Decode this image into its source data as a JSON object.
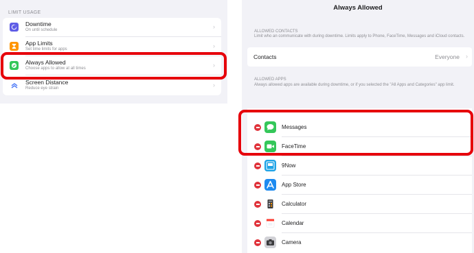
{
  "left": {
    "section_header": "LIMIT USAGE",
    "items": [
      {
        "title": "Downtime",
        "subtitle": "On until schedule",
        "icon": "moon-icon",
        "color": "#5e5ce6"
      },
      {
        "title": "App Limits",
        "subtitle": "Set time limits for apps",
        "icon": "hourglass-icon",
        "color": "#ff9500"
      },
      {
        "title": "Always Allowed",
        "subtitle": "Choose apps to allow at all times",
        "icon": "checkmark-icon",
        "color": "#34c759"
      },
      {
        "title": "Screen Distance",
        "subtitle": "Reduce eye strain",
        "icon": "screen-distance-icon",
        "color": "#4f7bf7"
      }
    ]
  },
  "right": {
    "title": "Always Allowed",
    "contacts_header": "ALLOWED CONTACTS",
    "contacts_description": "Limit who        an communicate with during downtime. Limits apply to Phone, FaceTime, Messages and iCloud contacts.",
    "contacts_label": "Contacts",
    "contacts_value": "Everyone",
    "apps_header": "ALLOWED APPS",
    "apps_description": "Always allowed apps are available during downtime, or if you selected the \"All Apps and Categories\" app limit.",
    "apps": [
      {
        "name": "Messages",
        "icon": "messages-icon",
        "color": "#34c759"
      },
      {
        "name": "FaceTime",
        "icon": "facetime-icon",
        "color": "#34c759"
      },
      {
        "name": "9Now",
        "icon": "9now-icon",
        "color": "#1fa3e6"
      },
      {
        "name": "App Store",
        "icon": "app-store-icon",
        "color": "#1e8bf0"
      },
      {
        "name": "Calculator",
        "icon": "calculator-icon",
        "color": "#3a3a3c"
      },
      {
        "name": "Calendar",
        "icon": "calendar-icon",
        "color": "#ffffff"
      },
      {
        "name": "Camera",
        "icon": "camera-icon",
        "color": "#8e8e93"
      }
    ]
  },
  "colors": {
    "highlight": "#e6000b",
    "delete": "#e0333b"
  }
}
